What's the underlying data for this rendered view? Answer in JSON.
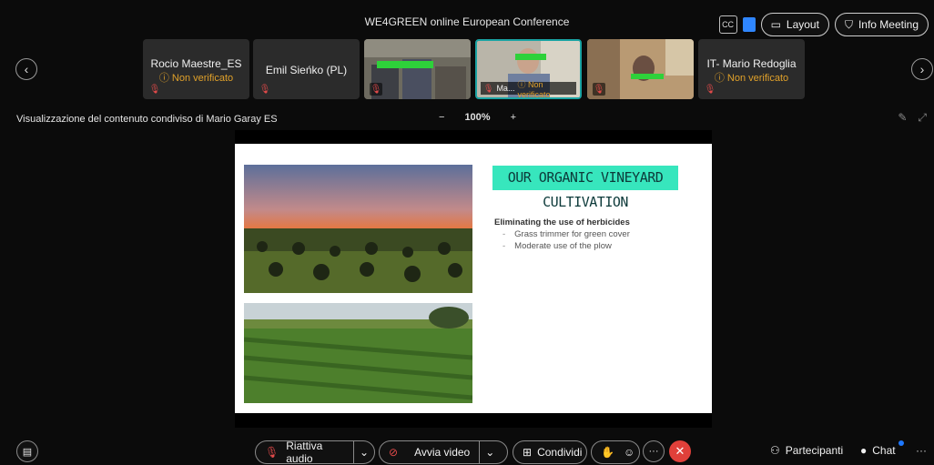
{
  "window": {
    "title": "WE4GREEN online European Conference"
  },
  "top_actions": {
    "cc_label": "CC",
    "layout_label": "Layout",
    "info_label": "Info Meeting"
  },
  "participants": [
    {
      "name": "Rocio Maestre_ES",
      "status": "Non verificato",
      "video": false
    },
    {
      "name": "Emil Sieńko (PL)",
      "status": "",
      "video": false
    },
    {
      "name": "",
      "status": "",
      "video": true
    },
    {
      "name": "Ma...",
      "status": "Non verificato",
      "video": true,
      "active": true
    },
    {
      "name": "",
      "status": "",
      "video": true
    },
    {
      "name": "IT- Mario Redoglia",
      "status": "Non verificato",
      "video": false
    }
  ],
  "share": {
    "title": "Visualizzazione del contenuto condiviso di Mario Garay ES",
    "zoom_minus": "−",
    "zoom_level": "100%",
    "zoom_plus": "+"
  },
  "slide": {
    "heading": "OUR ORGANIC VINEYARD CULTIVATION",
    "subheading": "Eliminating the use of herbicides",
    "bullets": [
      "Grass trimmer for green cover",
      "Moderate use of the plow"
    ]
  },
  "toolbar": {
    "audio_label": "Riattiva audio",
    "video_label": "Avvia video",
    "share_label": "Condividi",
    "participants_label": "Partecipanti",
    "chat_label": "Chat"
  },
  "colors": {
    "accent": "#1aa3a3",
    "warning": "#e0a12a",
    "end_call": "#e0403a",
    "slide_heading_bg": "#37e6bd"
  }
}
